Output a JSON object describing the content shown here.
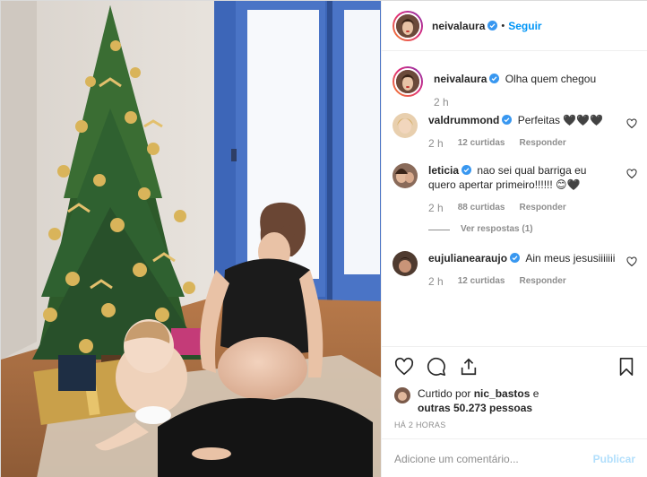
{
  "post": {
    "author": "neivalaura",
    "follow_label": "Seguir",
    "dot": "•"
  },
  "caption": {
    "author": "neivalaura",
    "text": "Olha quem chegou",
    "time": "2 h"
  },
  "comments": [
    {
      "user": "valdrummond",
      "text": "Perfeitas 🖤🖤🖤",
      "time": "2 h",
      "likes": "12 curtidas",
      "reply_label": "Responder"
    },
    {
      "user": "leticia",
      "text": "nao sei qual barriga eu quero apertar primeiro!!!!!! 😊🖤",
      "time": "2 h",
      "likes": "88 curtidas",
      "reply_label": "Responder",
      "view_replies": "Ver respostas (1)"
    },
    {
      "user": "eujulianearaujo",
      "text": "Ain meus jesusiiiiiii",
      "time": "2 h",
      "likes": "12 curtidas",
      "reply_label": "Responder"
    }
  ],
  "likes": {
    "prefix": "Curtido por",
    "user": "nic_bastos",
    "connector": "e",
    "others": "outras 50.273 pessoas"
  },
  "time_ago": "HÁ 2 HORAS",
  "add_comment": {
    "placeholder": "Adicione um comentário...",
    "publish_label": "Publicar"
  },
  "colors": {
    "verified": "#3897f0",
    "follow": "#0095f6",
    "publish_disabled": "#b2dffc",
    "secondary_text": "#8e8e8e"
  },
  "icons": [
    "verified-icon",
    "heart-icon",
    "comment-icon",
    "share-icon",
    "bookmark-icon"
  ]
}
